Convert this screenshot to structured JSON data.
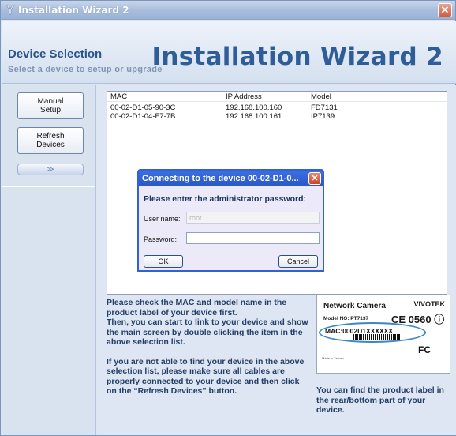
{
  "window": {
    "title": "Installation Wizard 2"
  },
  "header": {
    "title": "Device Selection",
    "subtitle": "Select a device to setup or upgrade",
    "brand_title": "Installation Wizard 2"
  },
  "sidebar": {
    "manual_setup": "Manual\nSetup",
    "refresh_devices": "Refresh\nDevices",
    "expander": "≫"
  },
  "device_list": {
    "columns": [
      "MAC",
      "IP Address",
      "Model"
    ],
    "rows": [
      [
        "00-02-D1-05-90-3C",
        "192.168.100.160",
        "FD7131"
      ],
      [
        "00-02-D1-04-F7-7B",
        "192.168.100.161",
        "IP7139"
      ]
    ]
  },
  "dialog": {
    "title": "Connecting to the device 00-02-D1-0...",
    "prompt": "Please enter the administrator password:",
    "username_label": "User name:",
    "username_value": "root",
    "password_label": "Password:",
    "password_value": "",
    "ok": "OK",
    "cancel": "Cancel"
  },
  "info": {
    "p1": "Please check the MAC and model name in the product label of your device first.",
    "p1b": "Then, you can start to link to your device and show the main screen by double clicking the item in the above selection list.",
    "p2": "If you are not able to find your device in the above selection list, please make sure all cables are properly connected to your device and then click on the “Refresh Devices” button.",
    "find": "You can find the product label in the rear/bottom part of your device."
  },
  "product_label": {
    "title": "Network Camera",
    "brand": "VIVOTEK",
    "model": "Model NO: PT7137",
    "ce": "CE 0560 ⓘ",
    "mac": "MAC:0002D1XXXXXX",
    "fc": "FC",
    "made_in": "Made in Taiwan"
  },
  "colors": {
    "accent": "#2f5d97",
    "dialog_title": "#2857c6",
    "close": "#cf5d43"
  }
}
